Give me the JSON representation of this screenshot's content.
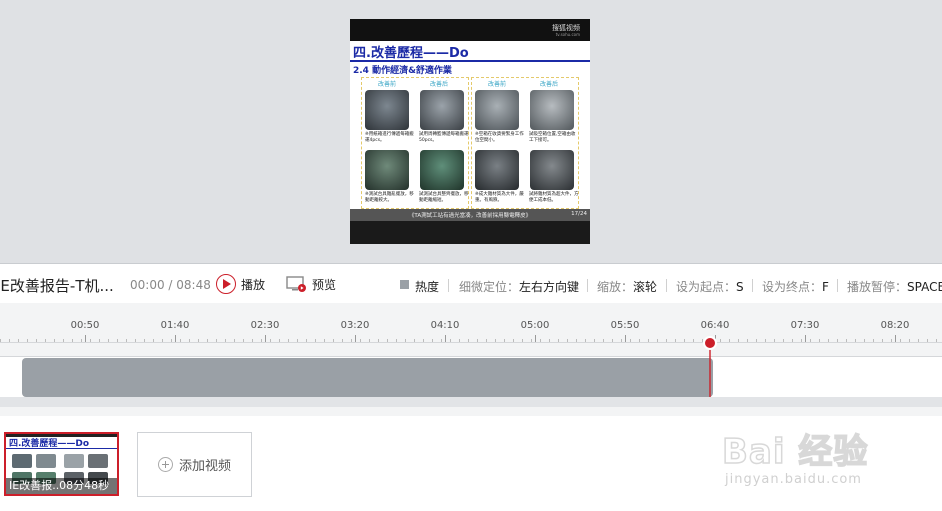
{
  "video": {
    "logo": "搜狐视频",
    "logo_sub": "tv.sohu.com",
    "slide_title": "四.改善歷程——Do",
    "slide_subtitle": "2.4 動作經濟&舒適作業",
    "before_label": "改善前",
    "after_label": "改善后",
    "captions": [
      "※用紙箱進行傳遞每箱搬運4pcs。",
      "試用周轉籃傳遞每箱搬運50pcs。",
      "※空箱在收貨要緊身工作位空間小。",
      "試吸空箱位置,空箱由收工下接可。",
      "※測試台具雜亂擺放，移動距離較大。",
      "試測試台具整齊擺放，移動距離縮短。",
      "※成大雜材質為大件，嚴重。有風險。",
      "試將雜材質為超大件，方便工成本低。"
    ],
    "footer_caption": "《TA測試工站有過光當凑，改善前採用縣電釋皮》",
    "page": "17/24"
  },
  "control": {
    "title": "IE改善报告-T机...",
    "current_time": "00:00",
    "total_time": " / 08:48",
    "play_label": "播放",
    "preview_label": "预览",
    "heat_label": "热度",
    "fine_key": "细微定位：",
    "fine_val": "左右方向键",
    "zoom_key": "缩放：",
    "zoom_val": "滚轮",
    "start_key": "设为起点：",
    "start_val": "S",
    "end_key": "设为终点：",
    "end_val": "F",
    "pause_key": "播放暂停：",
    "pause_val": "SPACE"
  },
  "ruler": {
    "labels": [
      "00:50",
      "01:40",
      "02:30",
      "03:20",
      "04:10",
      "05:00",
      "05:50",
      "06:40",
      "07:30",
      "08:20"
    ],
    "playhead": "06:40"
  },
  "clips": {
    "thumb_label": "IE改善报..08分48秒",
    "add_label": "添加视频"
  },
  "watermark": {
    "text": "Bai 经验",
    "sub": "jingyan.baidu.com"
  },
  "colors": {
    "accent": "#cc1f2a",
    "clip": "#9aa0a6",
    "slide_blue": "#1b2aa6"
  }
}
